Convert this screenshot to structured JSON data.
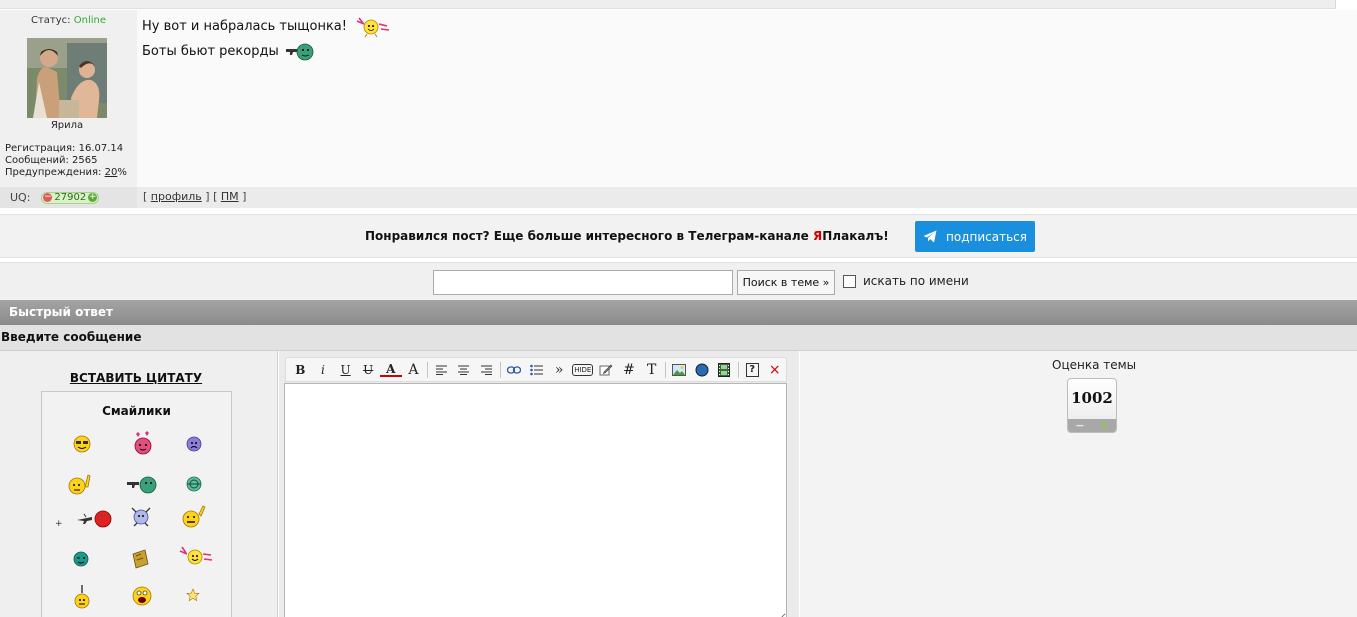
{
  "post": {
    "status_label": "Статус:",
    "status_value": "Online",
    "username": "Ярила",
    "registration": "Регистрация: 16.07.14",
    "messages": "Сообщений: 2565",
    "warnings_label": "Предупреждения:",
    "warnings_value": "20",
    "warnings_suffix": "%",
    "lines": [
      "Ну вот и набралась тыщонка!",
      "Боты бьют рекорды"
    ],
    "uq_label": "UQ:",
    "uq_value": "27902",
    "uq_minus": "−",
    "uq_plus": "+",
    "link_open": "[",
    "link_mid": "] [",
    "link_close": "]",
    "profile_link": "профиль",
    "pm_link": "ПМ"
  },
  "promo": {
    "text_before": "Понравился пост? Еще больше интересного в Телеграм-канале ",
    "brand_red": "Я",
    "brand_rest": "Плакалъ!",
    "button_label": "подписаться",
    "button_color": "#1a8fde"
  },
  "search": {
    "input_value": "",
    "button_label": "Поиск в теме »",
    "checkbox_label": "искать по имени"
  },
  "quick_reply": {
    "header": "Быстрый ответ",
    "subheader": "Введите сообщение",
    "insert_quote": "ВСТАВИТЬ ЦИТАТУ",
    "smiles_title": "Смайлики",
    "smiles_plus": "+",
    "editor_value": ""
  },
  "toolbar": {
    "bold": "B",
    "italic": "i",
    "underline": "U",
    "strike": "U",
    "color": "A",
    "size": "A",
    "quote": "»",
    "hide": "HIDE",
    "hash": "#",
    "text": "T",
    "help": "?",
    "close": "×"
  },
  "rating": {
    "label": "Оценка темы",
    "value": "1002",
    "minus": "−",
    "plus": "+"
  }
}
